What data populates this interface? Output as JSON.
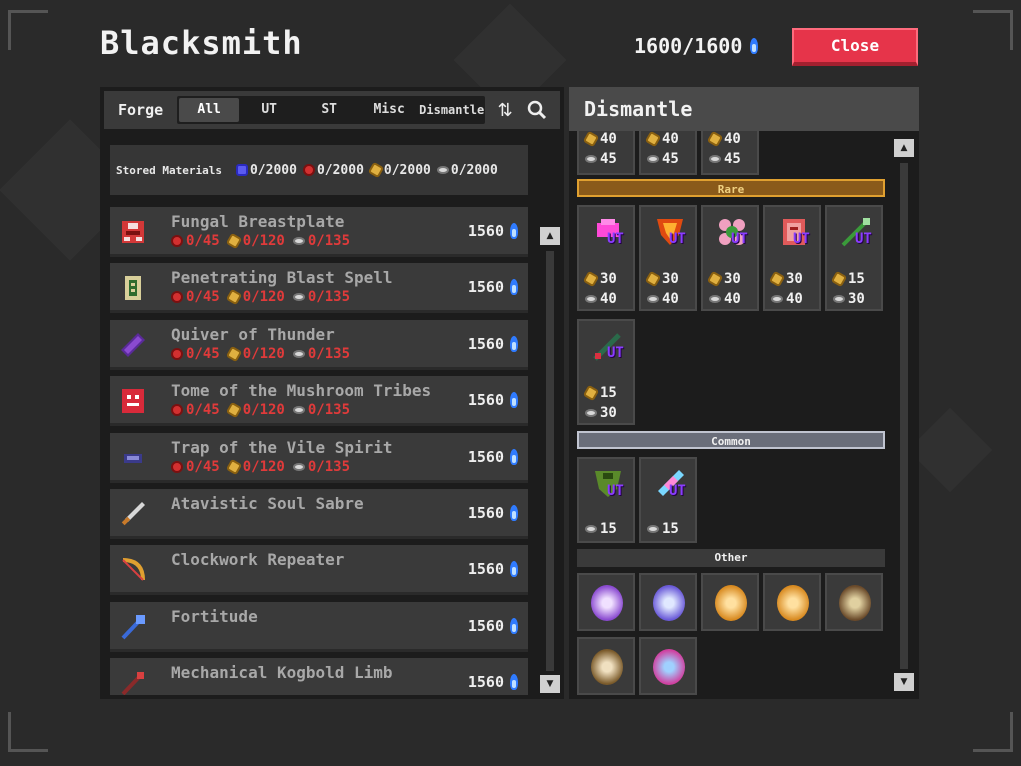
{
  "title": "Blacksmith",
  "essence": {
    "value": "1600/1600"
  },
  "close_label": "Close",
  "forge": {
    "label": "Forge",
    "tabs": [
      "All",
      "UT",
      "ST",
      "Misc",
      "Dismantle"
    ],
    "active_tab": "All",
    "materials_label": "Stored Materials",
    "materials": [
      {
        "icon": "blue-crystal-icon",
        "value": "0/2000"
      },
      {
        "icon": "red-gem-icon",
        "value": "0/2000"
      },
      {
        "icon": "gold-ore-icon",
        "value": "0/2000"
      },
      {
        "icon": "silver-ore-icon",
        "value": "0/2000"
      }
    ],
    "recipes": [
      {
        "name": "Fungal Breastplate",
        "icon": "fungal-breastplate-icon",
        "req": [
          "0/45",
          "0/120",
          "0/135"
        ],
        "cost": "1560"
      },
      {
        "name": "Penetrating Blast Spell",
        "icon": "spell-icon",
        "req": [
          "0/45",
          "0/120",
          "0/135"
        ],
        "cost": "1560"
      },
      {
        "name": "Quiver of Thunder",
        "icon": "quiver-icon",
        "req": [
          "0/45",
          "0/120",
          "0/135"
        ],
        "cost": "1560"
      },
      {
        "name": "Tome of the Mushroom Tribes",
        "icon": "tome-icon",
        "req": [
          "0/45",
          "0/120",
          "0/135"
        ],
        "cost": "1560"
      },
      {
        "name": "Trap of the Vile Spirit",
        "icon": "trap-icon",
        "req": [
          "0/45",
          "0/120",
          "0/135"
        ],
        "cost": "1560"
      },
      {
        "name": "Atavistic Soul Sabre",
        "icon": "sabre-icon",
        "req": [],
        "cost": "1560"
      },
      {
        "name": "Clockwork Repeater",
        "icon": "bow-icon",
        "req": [],
        "cost": "1560"
      },
      {
        "name": "Fortitude",
        "icon": "staff-icon",
        "req": [],
        "cost": "1560"
      },
      {
        "name": "Mechanical Kogbold Limb",
        "icon": "wand-icon",
        "req": [],
        "cost": "1560"
      }
    ]
  },
  "dismantle": {
    "title": "Dismantle",
    "top_partial": [
      {
        "gold": "40",
        "silver": "45"
      },
      {
        "gold": "40",
        "silver": "45"
      },
      {
        "gold": "40",
        "silver": "45"
      }
    ],
    "rare_label": "Rare",
    "rare": [
      {
        "icon": "pink-helm-icon",
        "badge": "UT",
        "gold": "30",
        "silver": "40"
      },
      {
        "icon": "flame-armor-icon",
        "badge": "UT",
        "gold": "30",
        "silver": "40"
      },
      {
        "icon": "flower-ring-icon",
        "badge": "UT",
        "gold": "30",
        "silver": "40"
      },
      {
        "icon": "pink-tome-icon",
        "badge": "UT",
        "gold": "30",
        "silver": "40"
      },
      {
        "icon": "green-bow-icon",
        "badge": "UT",
        "gold": "15",
        "silver": "30"
      },
      {
        "icon": "green-wand-icon",
        "badge": "UT",
        "gold": "15",
        "silver": "30"
      }
    ],
    "common_label": "Common",
    "common": [
      {
        "icon": "green-armor-icon",
        "badge": "UT",
        "silver": "15"
      },
      {
        "icon": "rainbow-sword-icon",
        "badge": "UT",
        "silver": "15"
      }
    ],
    "other_label": "Other",
    "other": [
      "purple-orb-icon",
      "purple-orb-icon",
      "gold-orb-icon",
      "gold-orb-icon",
      "brown-orb-icon",
      "brown-orb-icon",
      "blue-orb-icon"
    ]
  }
}
